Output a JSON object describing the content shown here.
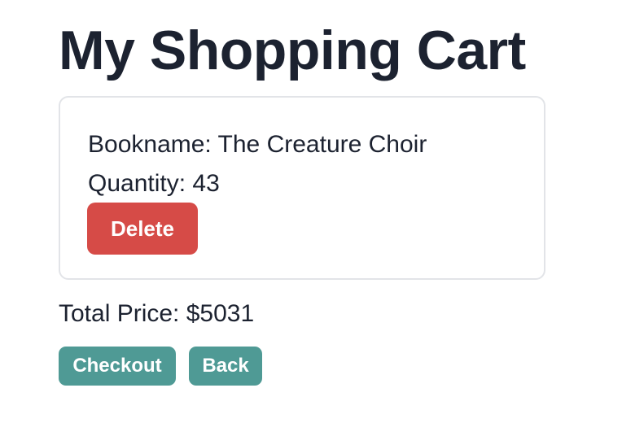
{
  "page": {
    "title": "My Shopping Cart"
  },
  "cart": {
    "items": [
      {
        "name_label": "Bookname: The Creature Choir",
        "quantity_label": "Quantity: 43",
        "delete_label": "Delete"
      }
    ],
    "total_label": "Total Price: $5031"
  },
  "actions": {
    "checkout_label": "Checkout",
    "back_label": "Back"
  },
  "colors": {
    "text": "#1c2230",
    "delete_button": "#d64b47",
    "action_button": "#4f9a95",
    "card_border": "#e2e4e8"
  }
}
